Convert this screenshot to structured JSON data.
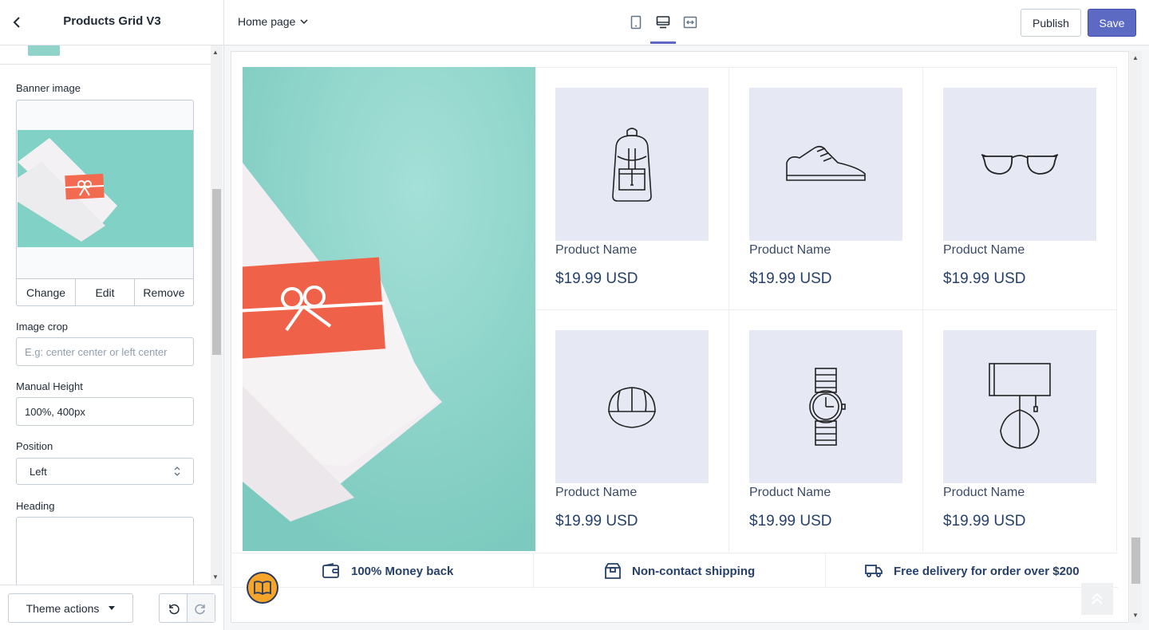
{
  "header": {
    "theme_title": "Products Grid V3",
    "page_select": "Home page",
    "publish_label": "Publish",
    "save_label": "Save",
    "active_view": "desktop"
  },
  "sidebar": {
    "banner_label": "Banner image",
    "banner_actions": [
      "Change",
      "Edit",
      "Remove"
    ],
    "image_crop_label": "Image crop",
    "image_crop_placeholder": "E.g: center center or left center",
    "manual_height_label": "Manual Height",
    "manual_height_value": "100%, 400px",
    "position_label": "Position",
    "position_value": "Left",
    "heading_label": "Heading",
    "theme_actions_label": "Theme actions"
  },
  "products": [
    {
      "name": "Product Name",
      "price": "$19.99 USD",
      "icon": "backpack-icon"
    },
    {
      "name": "Product Name",
      "price": "$19.99 USD",
      "icon": "sneaker-icon"
    },
    {
      "name": "Product Name",
      "price": "$19.99 USD",
      "icon": "glasses-icon"
    },
    {
      "name": "Product Name",
      "price": "$19.99 USD",
      "icon": "cap-icon"
    },
    {
      "name": "Product Name",
      "price": "$19.99 USD",
      "icon": "watch-icon"
    },
    {
      "name": "Product Name",
      "price": "$19.99 USD",
      "icon": "lamp-icon"
    }
  ],
  "features": [
    {
      "label": "100% Money back",
      "icon": "wallet-icon"
    },
    {
      "label": "Non-contact shipping",
      "icon": "box-icon"
    },
    {
      "label": "Free delivery for order over $200",
      "icon": "truck-icon"
    }
  ],
  "colors": {
    "accent": "#5c6ac4",
    "banner_teal": "#8ed6cb",
    "gift_card": "#f0614a",
    "product_bg": "#e6e8f4",
    "text_navy": "#26406a"
  }
}
